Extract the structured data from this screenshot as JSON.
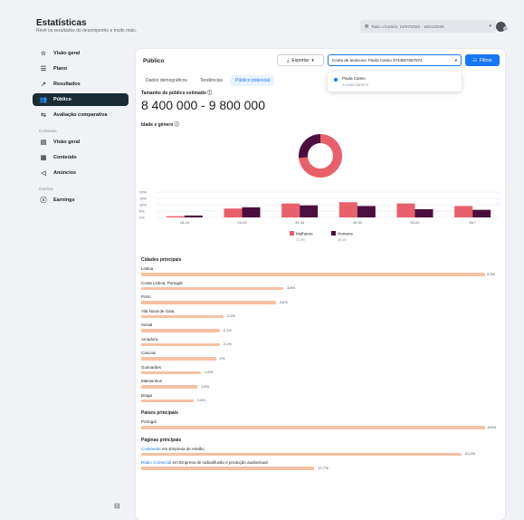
{
  "header": {
    "title": "Estatísticas",
    "subtitle": "Revê os resultados do desempenho e muito mais.",
    "date_range": "Todo o horário: 15/07/2023 - 15/01/2026"
  },
  "sidebar": {
    "items": [
      {
        "label": "Visão geral",
        "icon": "star-icon",
        "active": false
      },
      {
        "label": "Plano",
        "icon": "list-icon",
        "active": false
      },
      {
        "label": "Resultados",
        "icon": "trend-icon",
        "active": false
      },
      {
        "label": "Público",
        "icon": "people-icon",
        "active": true
      },
      {
        "label": "Avaliação comparativa",
        "icon": "compare-icon",
        "active": false
      }
    ],
    "section_content": "Conteúdo",
    "content_items": [
      {
        "label": "Visão geral",
        "icon": "grid-icon"
      },
      {
        "label": "Conteúdo",
        "icon": "content-icon"
      },
      {
        "label": "Anúncios",
        "icon": "megaphone-icon"
      }
    ],
    "section_earnings": "Ganhos",
    "earnings_items": [
      {
        "label": "Earnings",
        "icon": "dollar-icon"
      }
    ]
  },
  "panel": {
    "title": "Público",
    "export_label": "Exportar",
    "account_label": "Conta de anúncios: Paula Camio 3744857657874",
    "filters_label": "Filtros",
    "dropdown": {
      "name": "Paula Camio",
      "id": "3744857657874"
    },
    "tabs": [
      {
        "label": "Dados demográficos",
        "active": false
      },
      {
        "label": "Tendências",
        "active": false
      },
      {
        "label": "Público potencial",
        "active": true
      }
    ],
    "estimate_label": "Tamanho do público estimado",
    "estimate_value": "8 400 000 - 9 800 000",
    "age_gender_label": "Idade e género"
  },
  "chart_data": {
    "type": "bar",
    "categories": [
      "18-24",
      "25-34",
      "35-44",
      "45-54",
      "55-64",
      "65+"
    ],
    "yticks": [
      "20%",
      "15%",
      "10%",
      "5%",
      "0%"
    ],
    "ylim": [
      0,
      20
    ],
    "series": [
      {
        "name": "Mulheres",
        "values": [
          1,
          7,
          11,
          12,
          11,
          9
        ],
        "color": "#e8606a",
        "total": "72,3%"
      },
      {
        "name": "Homens",
        "values": [
          1.5,
          8,
          9.5,
          9,
          6.5,
          6
        ],
        "color": "#4b0f3f",
        "total": "26,3%"
      }
    ],
    "donut": [
      {
        "name": "Mulheres",
        "value": 72.3,
        "color": "#e8606a"
      },
      {
        "name": "Homens",
        "value": 26.3,
        "color": "#4b0f3f"
      }
    ]
  },
  "cities": {
    "title": "Cidades principais",
    "items": [
      {
        "label": "Lisboa",
        "value": "9,2%",
        "pct": 9.2
      },
      {
        "label": "Costa Lisboa, Portugal",
        "value": "3,8%",
        "pct": 3.8
      },
      {
        "label": "Porto",
        "value": "3,6%",
        "pct": 3.6
      },
      {
        "label": "Vila Nova de Gaia",
        "value": "2,2%",
        "pct": 2.2
      },
      {
        "label": "Seixal",
        "value": "2,1%",
        "pct": 2.1
      },
      {
        "label": "Amadora",
        "value": "2,1%",
        "pct": 2.1
      },
      {
        "label": "Cascais",
        "value": "2%",
        "pct": 2.0
      },
      {
        "label": "Guimarães",
        "value": "1,6%",
        "pct": 1.6
      },
      {
        "label": "Matosinhos",
        "value": "1,5%",
        "pct": 1.5
      },
      {
        "label": "Braga",
        "value": "1,4%",
        "pct": 1.4
      }
    ]
  },
  "countries": {
    "title": "Países principais",
    "items": [
      {
        "label": "Portugal",
        "value": "100%",
        "pct": 100
      }
    ]
  },
  "pages": {
    "title": "Páginas principais",
    "items": [
      {
        "link": "Continente",
        "rest": " em Empresa de retalho",
        "value": "51,2%",
        "pct": 51.2
      },
      {
        "link": "Rádio Comercial",
        "rest": " em Empresa de radiodifusão e produção audiovisual",
        "value": "27,7%",
        "pct": 27.7
      }
    ]
  }
}
